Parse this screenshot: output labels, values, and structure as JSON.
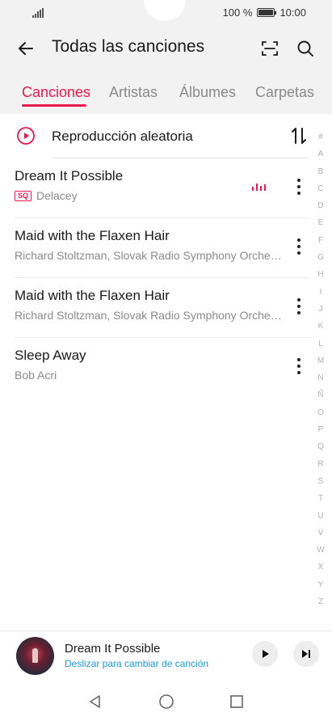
{
  "status": {
    "battery_text": "100 %",
    "time": "10:00",
    "battery_level": 1.0
  },
  "header": {
    "title": "Todas las canciones",
    "icons": [
      "back-arrow-icon",
      "scan-icon",
      "search-icon"
    ]
  },
  "tabs": [
    {
      "label": "Canciones",
      "active": true
    },
    {
      "label": "Artistas",
      "active": false
    },
    {
      "label": "Álbumes",
      "active": false
    },
    {
      "label": "Carpetas",
      "active": false
    }
  ],
  "shuffle": {
    "label": "Reproducción aleatoria",
    "icon": "play-circle-icon",
    "sort_icon": "sort-icon"
  },
  "songs": [
    {
      "title": "Dream It Possible",
      "artist": "Delacey",
      "badge": "SQ",
      "playing": true
    },
    {
      "title": "Maid with the Flaxen Hair",
      "artist": "Richard Stoltzman, Slovak Radio Symphony Orche…",
      "badge": "",
      "playing": false
    },
    {
      "title": "Maid with the Flaxen Hair",
      "artist": "Richard Stoltzman, Slovak Radio Symphony Orche…",
      "badge": "",
      "playing": false
    },
    {
      "title": "Sleep Away",
      "artist": "Bob Acri",
      "badge": "",
      "playing": false
    }
  ],
  "alphabet": [
    "#",
    "A",
    "B",
    "C",
    "D",
    "E",
    "F",
    "G",
    "H",
    "I",
    "J",
    "K",
    "L",
    "M",
    "N",
    "Ñ",
    "O",
    "P",
    "Q",
    "R",
    "S",
    "T",
    "U",
    "V",
    "W",
    "X",
    "Y",
    "Z"
  ],
  "mini_player": {
    "title": "Dream It Possible",
    "hint": "Deslizar para cambiar de canción",
    "icons": [
      "play-icon",
      "next-icon"
    ]
  },
  "colors": {
    "accent": "#e8174e",
    "link": "#2196d3",
    "background": "#f2f2f2"
  }
}
